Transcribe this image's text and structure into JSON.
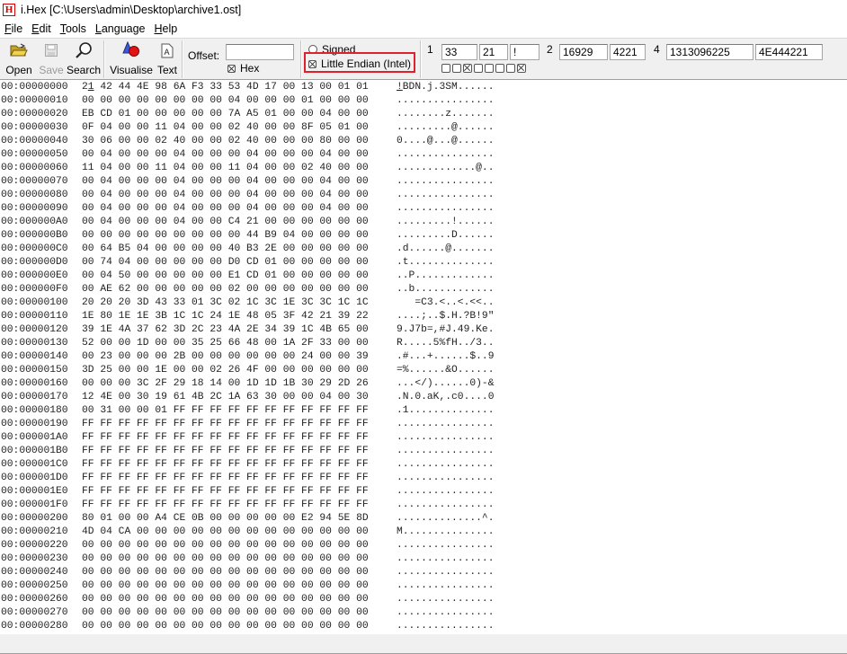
{
  "window": {
    "icon_letter": "H",
    "title": "i.Hex [C:\\Users\\admin\\Desktop\\archive1.ost]"
  },
  "menu": [
    {
      "label": "File",
      "accel": "F"
    },
    {
      "label": "Edit",
      "accel": "E"
    },
    {
      "label": "Tools",
      "accel": "T"
    },
    {
      "label": "Language",
      "accel": "L"
    },
    {
      "label": "Help",
      "accel": "H"
    }
  ],
  "toolbar": {
    "open_label": "Open",
    "save_label": "Save",
    "search_label": "Search",
    "visualise_label": "Visualise",
    "text_label": "Text",
    "offset_label": "Offset:",
    "offset_value": "",
    "hex_label": "Hex",
    "hex_checked": true,
    "signed_label": "Signed",
    "signed_checked": false,
    "little_endian_label": "Little Endian (Intel)",
    "little_endian_checked": true
  },
  "inspector": {
    "byte1": {
      "label": "1",
      "decimal": "33",
      "hex": "21",
      "char": "!"
    },
    "byte2": {
      "label": "2",
      "decimal": "16929",
      "hex": "4221"
    },
    "byte4": {
      "label": "4",
      "decimal": "1313096225",
      "hex": "4E444221"
    },
    "bits": [
      false,
      false,
      true,
      false,
      false,
      false,
      false,
      true
    ]
  },
  "hex_rows": [
    {
      "addr": "00:00000000",
      "bytes": "21 42 44 4E 98 6A F3 33 53 4D 17 00 13 00 01 01",
      "ascii": "!BDN.j.3SM......"
    },
    {
      "addr": "00:00000010",
      "bytes": "00 00 00 00 00 00 00 00 04 00 00 00 01 00 00 00",
      "ascii": "................"
    },
    {
      "addr": "00:00000020",
      "bytes": "EB CD 01 00 00 00 00 00 7A A5 01 00 00 04 00 00",
      "ascii": "........z......."
    },
    {
      "addr": "00:00000030",
      "bytes": "0F 04 00 00 11 04 00 00 02 40 00 00 8F 05 01 00",
      "ascii": ".........@......"
    },
    {
      "addr": "00:00000040",
      "bytes": "30 06 00 00 02 40 00 00 02 40 00 00 00 80 00 00",
      "ascii": "0....@...@......"
    },
    {
      "addr": "00:00000050",
      "bytes": "00 04 00 00 00 04 00 00 00 04 00 00 00 04 00 00",
      "ascii": "................"
    },
    {
      "addr": "00:00000060",
      "bytes": "11 04 00 00 11 04 00 00 11 04 00 00 02 40 00 00",
      "ascii": ".............@.."
    },
    {
      "addr": "00:00000070",
      "bytes": "00 04 00 00 00 04 00 00 00 04 00 00 00 04 00 00",
      "ascii": "................"
    },
    {
      "addr": "00:00000080",
      "bytes": "00 04 00 00 00 04 00 00 00 04 00 00 00 04 00 00",
      "ascii": "................"
    },
    {
      "addr": "00:00000090",
      "bytes": "00 04 00 00 00 04 00 00 00 04 00 00 00 04 00 00",
      "ascii": "................"
    },
    {
      "addr": "00:000000A0",
      "bytes": "00 04 00 00 00 04 00 00 C4 21 00 00 00 00 00 00",
      "ascii": ".........!......"
    },
    {
      "addr": "00:000000B0",
      "bytes": "00 00 00 00 00 00 00 00 00 44 B9 04 00 00 00 00",
      "ascii": ".........D......"
    },
    {
      "addr": "00:000000C0",
      "bytes": "00 64 B5 04 00 00 00 00 40 B3 2E 00 00 00 00 00",
      "ascii": ".d......@......."
    },
    {
      "addr": "00:000000D0",
      "bytes": "00 74 04 00 00 00 00 00 D0 CD 01 00 00 00 00 00",
      "ascii": ".t.............."
    },
    {
      "addr": "00:000000E0",
      "bytes": "00 04 50 00 00 00 00 00 E1 CD 01 00 00 00 00 00",
      "ascii": "..P............."
    },
    {
      "addr": "00:000000F0",
      "bytes": "00 AE 62 00 00 00 00 00 02 00 00 00 00 00 00 00",
      "ascii": "..b............."
    },
    {
      "addr": "00:00000100",
      "bytes": "20 20 20 3D 43 33 01 3C 02 1C 3C 1E 3C 3C 1C 1C",
      "ascii": "   =C3.<..<.<<.."
    },
    {
      "addr": "00:00000110",
      "bytes": "1E 80 1E 1E 3B 1C 1C 24 1E 48 05 3F 42 21 39 22",
      "ascii": "....;..$.H.?B!9\""
    },
    {
      "addr": "00:00000120",
      "bytes": "39 1E 4A 37 62 3D 2C 23 4A 2E 34 39 1C 4B 65 00",
      "ascii": "9.J7b=,#J.49.Ke."
    },
    {
      "addr": "00:00000130",
      "bytes": "52 00 00 1D 00 00 35 25 66 48 00 1A 2F 33 00 00",
      "ascii": "R.....5%fH../3.."
    },
    {
      "addr": "00:00000140",
      "bytes": "00 23 00 00 00 2B 00 00 00 00 00 00 24 00 00 39",
      "ascii": ".#...+......$..9"
    },
    {
      "addr": "00:00000150",
      "bytes": "3D 25 00 00 1E 00 00 02 26 4F 00 00 00 00 00 00",
      "ascii": "=%......&O......"
    },
    {
      "addr": "00:00000160",
      "bytes": "00 00 00 3C 2F 29 18 14 00 1D 1D 1B 30 29 2D 26",
      "ascii": "...</)......0)-&"
    },
    {
      "addr": "00:00000170",
      "bytes": "12 4E 00 30 19 61 4B 2C 1A 63 30 00 00 04 00 30",
      "ascii": ".N.0.aK,.c0....0"
    },
    {
      "addr": "00:00000180",
      "bytes": "00 31 00 00 01 FF FF FF FF FF FF FF FF FF FF FF",
      "ascii": ".1.............."
    },
    {
      "addr": "00:00000190",
      "bytes": "FF FF FF FF FF FF FF FF FF FF FF FF FF FF FF FF",
      "ascii": "................"
    },
    {
      "addr": "00:000001A0",
      "bytes": "FF FF FF FF FF FF FF FF FF FF FF FF FF FF FF FF",
      "ascii": "................"
    },
    {
      "addr": "00:000001B0",
      "bytes": "FF FF FF FF FF FF FF FF FF FF FF FF FF FF FF FF",
      "ascii": "................"
    },
    {
      "addr": "00:000001C0",
      "bytes": "FF FF FF FF FF FF FF FF FF FF FF FF FF FF FF FF",
      "ascii": "................"
    },
    {
      "addr": "00:000001D0",
      "bytes": "FF FF FF FF FF FF FF FF FF FF FF FF FF FF FF FF",
      "ascii": "................"
    },
    {
      "addr": "00:000001E0",
      "bytes": "FF FF FF FF FF FF FF FF FF FF FF FF FF FF FF FF",
      "ascii": "................"
    },
    {
      "addr": "00:000001F0",
      "bytes": "FF FF FF FF FF FF FF FF FF FF FF FF FF FF FF FF",
      "ascii": "................"
    },
    {
      "addr": "00:00000200",
      "bytes": "80 01 00 00 A4 CE 0B 00 00 00 00 00 E2 94 5E 8D",
      "ascii": "..............^."
    },
    {
      "addr": "00:00000210",
      "bytes": "4D 04 CA 00 00 00 00 00 00 00 00 00 00 00 00 00",
      "ascii": "M..............."
    },
    {
      "addr": "00:00000220",
      "bytes": "00 00 00 00 00 00 00 00 00 00 00 00 00 00 00 00",
      "ascii": "................"
    },
    {
      "addr": "00:00000230",
      "bytes": "00 00 00 00 00 00 00 00 00 00 00 00 00 00 00 00",
      "ascii": "................"
    },
    {
      "addr": "00:00000240",
      "bytes": "00 00 00 00 00 00 00 00 00 00 00 00 00 00 00 00",
      "ascii": "................"
    },
    {
      "addr": "00:00000250",
      "bytes": "00 00 00 00 00 00 00 00 00 00 00 00 00 00 00 00",
      "ascii": "................"
    },
    {
      "addr": "00:00000260",
      "bytes": "00 00 00 00 00 00 00 00 00 00 00 00 00 00 00 00",
      "ascii": "................"
    },
    {
      "addr": "00:00000270",
      "bytes": "00 00 00 00 00 00 00 00 00 00 00 00 00 00 00 00",
      "ascii": "................"
    },
    {
      "addr": "00:00000280",
      "bytes": "00 00 00 00 00 00 00 00 00 00 00 00 00 00 00 00",
      "ascii": "................"
    }
  ],
  "colors": {
    "highlight_box": "#e0202a",
    "app_icon": "#d40000"
  }
}
